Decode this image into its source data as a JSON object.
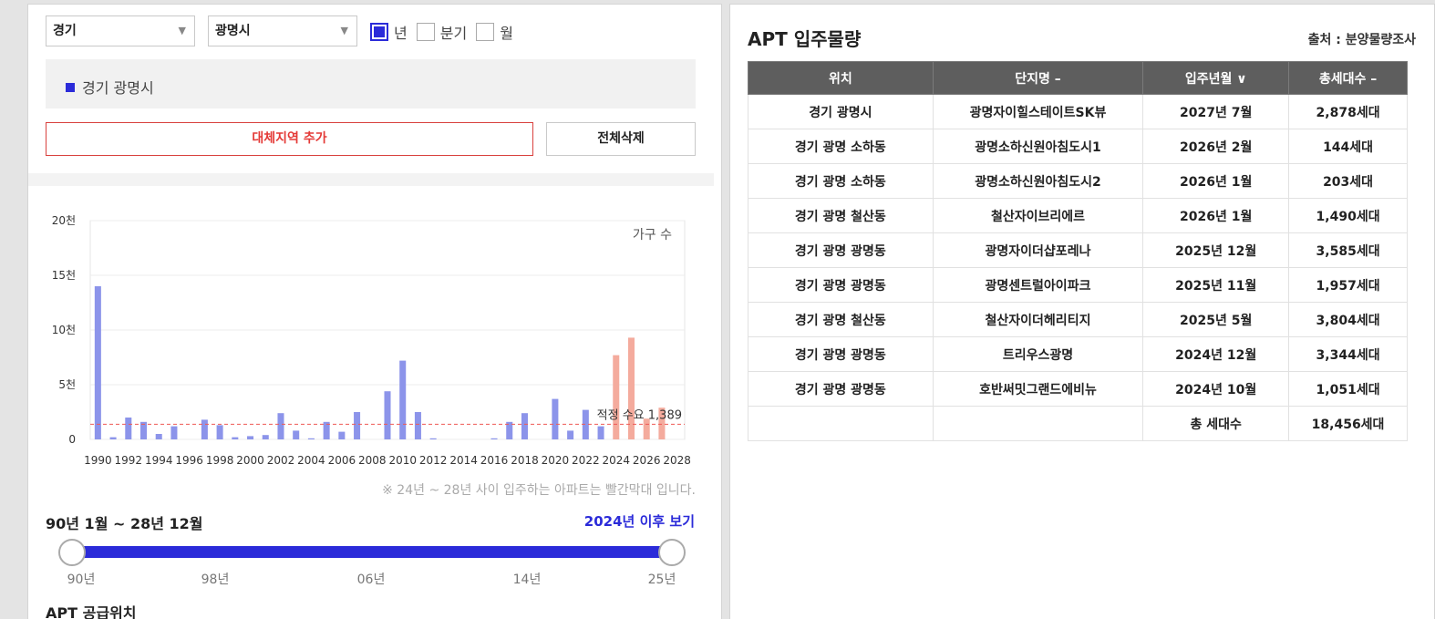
{
  "filters": {
    "region": "경기",
    "city": "광명시",
    "period_options": [
      {
        "label": "년",
        "checked": true
      },
      {
        "label": "분기",
        "checked": false
      },
      {
        "label": "월",
        "checked": false
      }
    ]
  },
  "selected_region_label": "경기 광명시",
  "buttons": {
    "add_alternative": "대체지역 추가",
    "delete_all": "전체삭제"
  },
  "chart_data": {
    "type": "bar",
    "unit_label": "가구 수",
    "y_ticks": [
      "0",
      "5천",
      "10천",
      "15천",
      "20천"
    ],
    "ylim": [
      0,
      20000
    ],
    "x_tick_labels": [
      "1990",
      "1992",
      "1994",
      "1996",
      "1998",
      "2000",
      "2002",
      "2004",
      "2006",
      "2008",
      "2010",
      "2012",
      "2014",
      "2016",
      "2018",
      "2020",
      "2022",
      "2024",
      "2026",
      "2028"
    ],
    "series": [
      {
        "years": [
          1990,
          1991,
          1992,
          1993,
          1994,
          1995,
          1996,
          1997,
          1998,
          1999,
          2000,
          2001,
          2002,
          2003,
          2004,
          2005,
          2006,
          2007,
          2008,
          2009,
          2010,
          2011,
          2012,
          2013,
          2014,
          2015,
          2016,
          2017,
          2018,
          2019,
          2020,
          2021,
          2022,
          2023
        ],
        "values": [
          14000,
          200,
          2000,
          1600,
          500,
          1200,
          0,
          1800,
          1300,
          200,
          300,
          400,
          2400,
          800,
          100,
          1600,
          700,
          2500,
          0,
          4400,
          7200,
          2500,
          100,
          0,
          0,
          0,
          100,
          1600,
          2400,
          0,
          3700,
          800,
          2700,
          1200
        ],
        "color": "#8c94ea"
      },
      {
        "years": [
          2024,
          2025,
          2026,
          2027,
          2028
        ],
        "values": [
          7700,
          9300,
          1900,
          2900,
          0
        ],
        "color": "#f4ab9d"
      }
    ],
    "reference_line": {
      "label": "적정 수요 1,389",
      "value": 1389,
      "color": "#ee5a56"
    }
  },
  "note": "※ 24년 ~ 28년 사이 입주하는 아파트는 빨간막대 입니다.",
  "period_range": "90년 1월 ~ 28년 12월",
  "view_after_link": "2024년 이후 보기",
  "slider": {
    "labels": [
      "90년",
      "98년",
      "06년",
      "14년",
      "25년"
    ],
    "range_fraction": [
      0,
      1
    ]
  },
  "supply_location_title": "APT 공급위치",
  "right_panel": {
    "title": "APT 입주물량",
    "source": "출처 : 분양물량조사",
    "columns": [
      "위치",
      "단지명 –",
      "입주년월 ∨",
      "총세대수 –"
    ],
    "rows": [
      [
        "경기 광명시",
        "광명자이힐스테이트SK뷰",
        "2027년 7월",
        "2,878세대"
      ],
      [
        "경기 광명 소하동",
        "광명소하신원아침도시1",
        "2026년 2월",
        "144세대"
      ],
      [
        "경기 광명 소하동",
        "광명소하신원아침도시2",
        "2026년 1월",
        "203세대"
      ],
      [
        "경기 광명 철산동",
        "철산자이브리에르",
        "2026년 1월",
        "1,490세대"
      ],
      [
        "경기 광명 광명동",
        "광명자이더샵포레나",
        "2025년 12월",
        "3,585세대"
      ],
      [
        "경기 광명 광명동",
        "광명센트럴아이파크",
        "2025년 11월",
        "1,957세대"
      ],
      [
        "경기 광명 철산동",
        "철산자이더헤리티지",
        "2025년 5월",
        "3,804세대"
      ],
      [
        "경기 광명 광명동",
        "트리우스광명",
        "2024년 12월",
        "3,344세대"
      ],
      [
        "경기 광명 광명동",
        "호반써밋그랜드에비뉴",
        "2024년 10월",
        "1,051세대"
      ]
    ],
    "total_label": "총 세대수",
    "total_value": "18,456세대"
  }
}
